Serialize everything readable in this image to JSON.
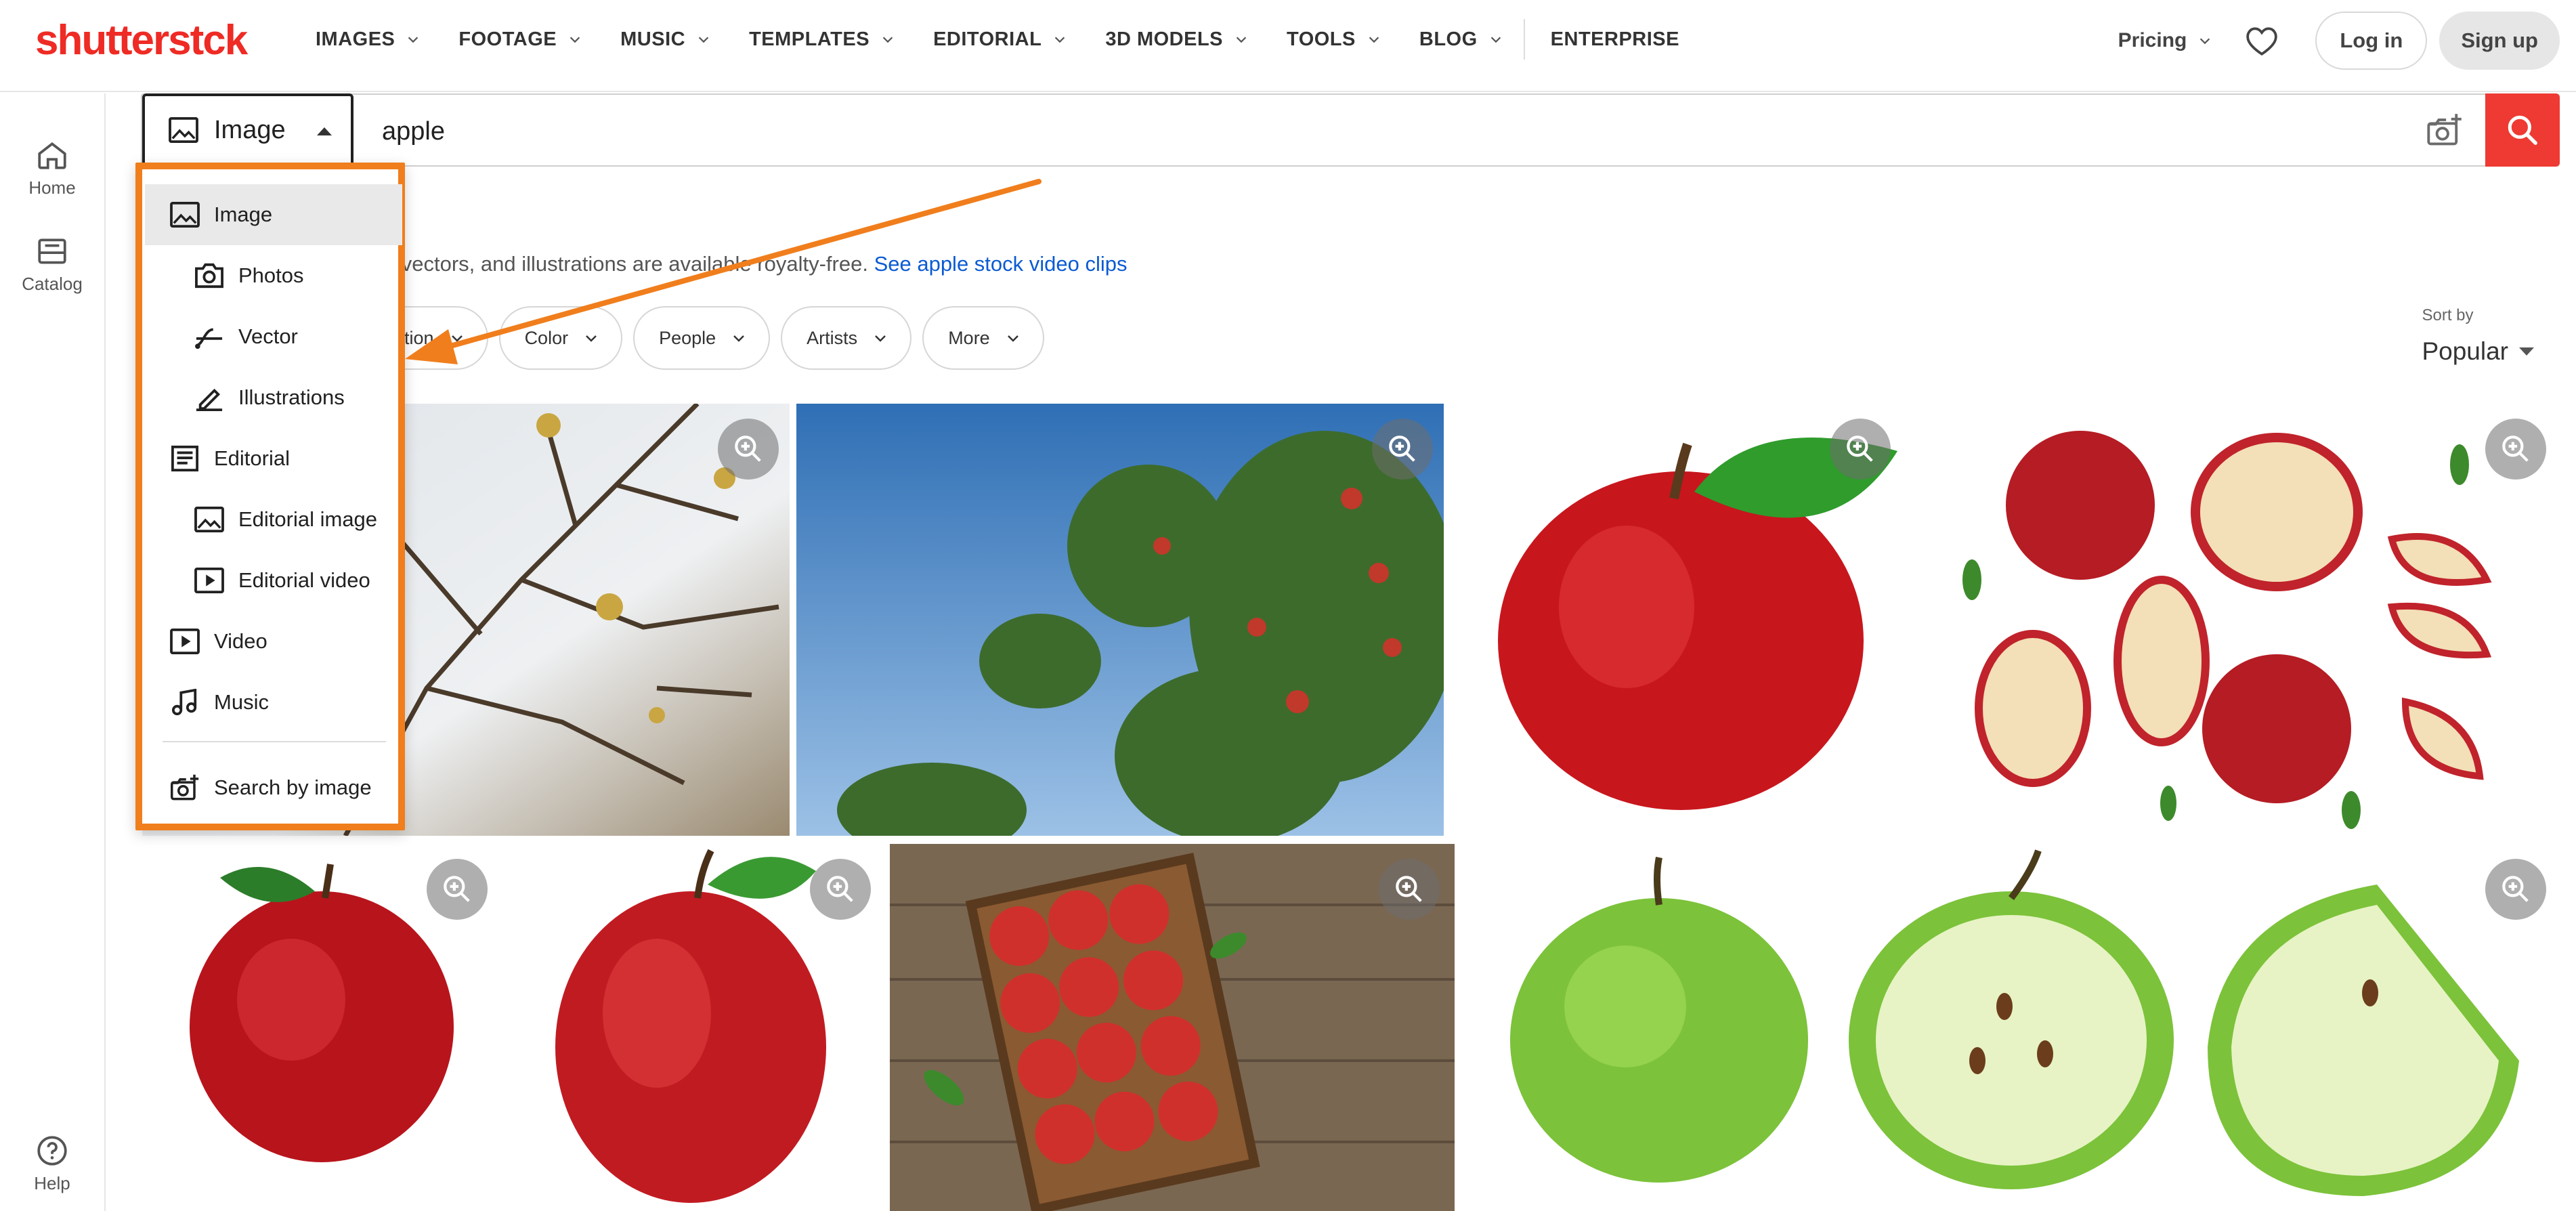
{
  "nav": {
    "logo": "shutterstck",
    "links": [
      "IMAGES",
      "FOOTAGE",
      "MUSIC",
      "TEMPLATES",
      "EDITORIAL",
      "3D MODELS",
      "TOOLS",
      "BLOG"
    ],
    "enterprise": "ENTERPRISE",
    "pricing": "Pricing",
    "login": "Log in",
    "signup": "Sign up"
  },
  "rail": {
    "home": "Home",
    "catalog": "Catalog",
    "help": "Help"
  },
  "search": {
    "type_label": "Image",
    "query": "apple"
  },
  "results": {
    "info_text": "s, vectors, and illustrations are available royalty-free.",
    "info_link": "See apple stock video clips"
  },
  "filters": {
    "partial": "ation",
    "chips": [
      "Color",
      "People",
      "Artists",
      "More"
    ]
  },
  "sort": {
    "caption": "Sort by",
    "value": "Popular"
  },
  "dropdown": {
    "items": [
      {
        "label": "Image",
        "icon": "image-icon"
      },
      {
        "label": "Photos",
        "icon": "camera-icon"
      },
      {
        "label": "Vector",
        "icon": "vector-icon"
      },
      {
        "label": "Illustrations",
        "icon": "pen-icon"
      },
      {
        "label": "Editorial",
        "icon": "editorial-icon"
      },
      {
        "label": "Editorial image",
        "icon": "image-icon"
      },
      {
        "label": "Editorial video",
        "icon": "video-icon"
      },
      {
        "label": "Video",
        "icon": "video-icon"
      },
      {
        "label": "Music",
        "icon": "music-note-icon"
      },
      {
        "label": "Search by image",
        "icon": "camera-plus-icon"
      }
    ]
  },
  "colors": {
    "brand": "#ee2b24",
    "search_button": "#ee3a32",
    "annotation": "#f07e1c",
    "link": "#0b5bd3"
  }
}
